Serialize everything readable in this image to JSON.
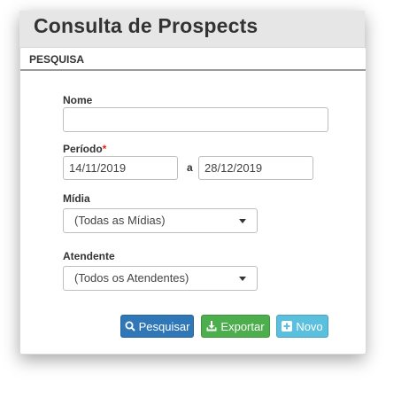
{
  "page": {
    "title": "Consulta de Prospects"
  },
  "panel": {
    "header": "PESQUISA"
  },
  "form": {
    "nome": {
      "label": "Nome",
      "value": ""
    },
    "periodo": {
      "label": "Período",
      "required_mark": "*",
      "start": "14/11/2019",
      "separator": "a",
      "end": "28/12/2019"
    },
    "midia": {
      "label": "Mídia",
      "selected": "(Todas as Mídias)"
    },
    "atendente": {
      "label": "Atendente",
      "selected": "(Todos os Atendentes)"
    }
  },
  "buttons": {
    "search": {
      "label": "Pesquisar",
      "icon": "search-icon",
      "color": "#2f77b7"
    },
    "export": {
      "label": "Exportar",
      "icon": "download-icon",
      "color": "#4cae4c"
    },
    "new": {
      "label": "Novo",
      "icon": "plus-square-icon",
      "color": "#5bc0de"
    }
  }
}
